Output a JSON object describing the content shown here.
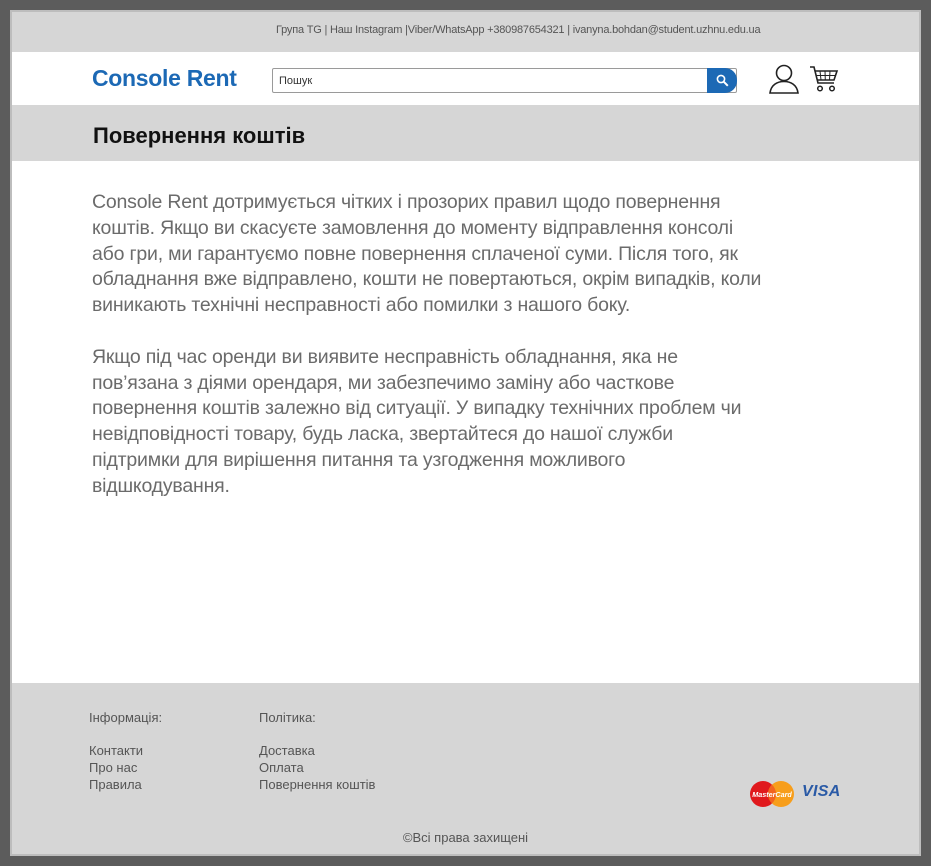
{
  "topbar": {
    "contacts": "Група TG | Наш Instagram |Viber/WhatsApp +380987654321 | ivanyna.bohdan@student.uzhnu.edu.ua"
  },
  "header": {
    "logo": "Console Rent",
    "search_placeholder": "Пошук",
    "icons": [
      "search-icon",
      "user-icon",
      "cart-icon"
    ],
    "brand_color": "#1c69b5"
  },
  "page": {
    "title": "Повернення коштів",
    "paragraphs": [
      "Console Rent дотримується чітких і прозорих правил щодо повернення коштів. Якщо ви скасуєте замовлення до моменту відправлення консолі або гри, ми гарантуємо повне повернення сплаченої суми. Після того, як обладнання вже відправлено, кошти не повертаються, окрім випадків, коли виникають технічні несправності або помилки з нашого боку.",
      "Якщо під час оренди ви виявите несправність обладнання, яка не пов’язана з діями орендаря, ми забезпечимо заміну або часткове повернення коштів залежно від ситуації. У випадку технічних проблем чи невідповідності товару, будь ласка, звертайтеся до нашої служби підтримки для вирішення питання та узгодження можливого відшкодування."
    ]
  },
  "footer": {
    "info_heading": "Інформація:",
    "info_links": [
      "Контакти",
      "Про нас",
      "Правила"
    ],
    "policy_heading": "Політика:",
    "policy_links": [
      "Доставка",
      "Оплата",
      "Повернення коштів"
    ],
    "payment_mastercard": "MasterCard",
    "payment_visa": "VISA",
    "copyright": "©Всі права захищені"
  }
}
